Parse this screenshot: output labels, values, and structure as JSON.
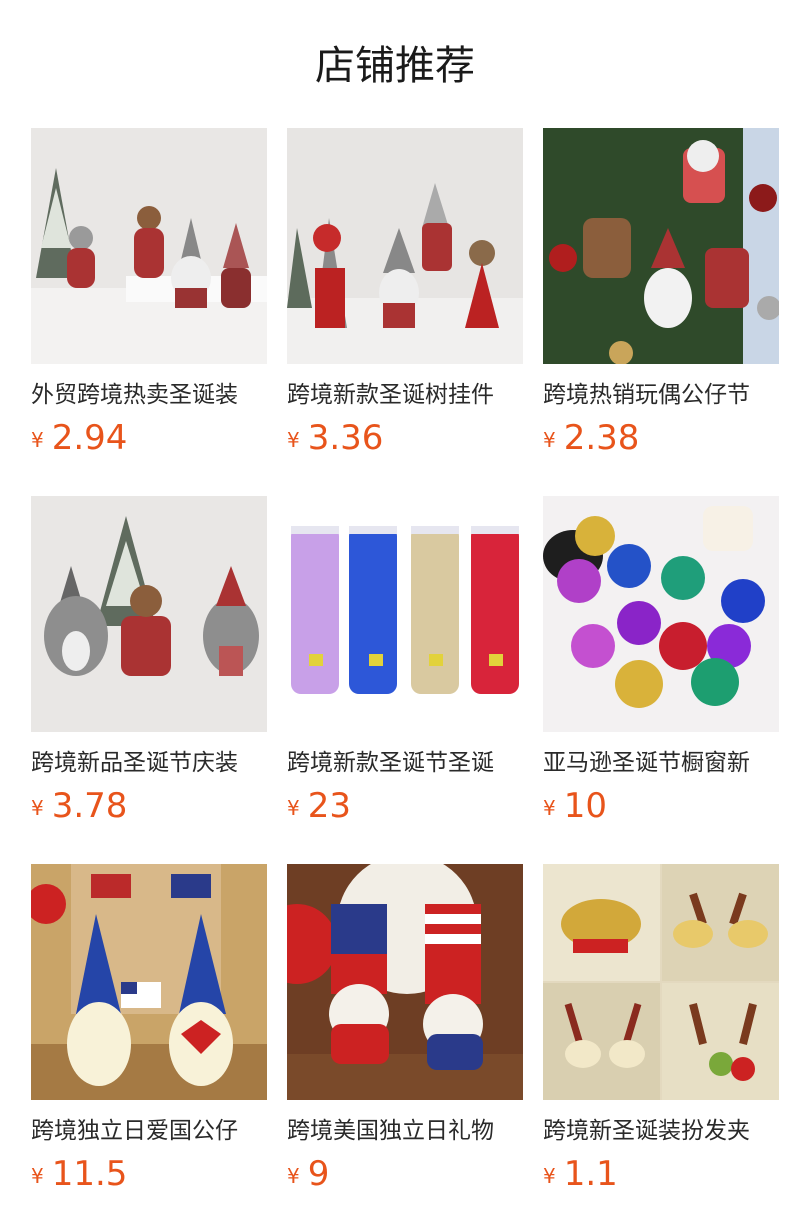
{
  "page_title": "店铺推荐",
  "currency_symbol": "¥",
  "accent_color": "#e8541b",
  "products": [
    {
      "name": "外贸跨境热卖圣诞装",
      "price": "2.94"
    },
    {
      "name": "跨境新款圣诞树挂件",
      "price": "3.36"
    },
    {
      "name": "跨境热销玩偶公仔节",
      "price": "2.38"
    },
    {
      "name": "跨境新品圣诞节庆装",
      "price": "3.78"
    },
    {
      "name": "跨境新款圣诞节圣诞",
      "price": "23"
    },
    {
      "name": "亚马逊圣诞节橱窗新",
      "price": "10"
    },
    {
      "name": "跨境独立日爱国公仔",
      "price": "11.5"
    },
    {
      "name": "跨境美国独立日礼物",
      "price": "9"
    },
    {
      "name": "跨境新圣诞装扮发夹",
      "price": "1.1"
    }
  ]
}
